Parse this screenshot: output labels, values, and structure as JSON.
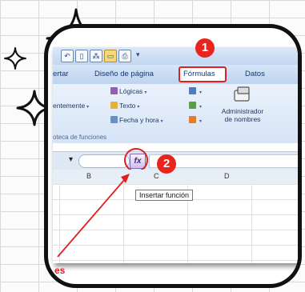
{
  "quick_access": {
    "dropdown_glyph": "▾"
  },
  "tabs": [
    "ertar",
    "Diseño de página",
    "Fórmulas",
    "Datos"
  ],
  "ribbon": {
    "logical": "Lógicas",
    "recent": "entemente",
    "text": "Texto",
    "datetime": "Fecha y hora",
    "name_manager_line1": "Administrador",
    "name_manager_line2": "de nombres",
    "group_label": "oteca de funciones",
    "dropdown_glyph": "▾"
  },
  "formula_bar": {
    "fx_glyph": "fx"
  },
  "columns": [
    "B",
    "C",
    "D"
  ],
  "tooltip": "Insertar función",
  "badges": [
    "1",
    "2"
  ],
  "bottom_partial_text": "es",
  "colors": {
    "accent_red": "#e02020",
    "badge_red": "#e8251c",
    "ribbon_blue": "#d7e5f7",
    "frame": "#111111"
  }
}
